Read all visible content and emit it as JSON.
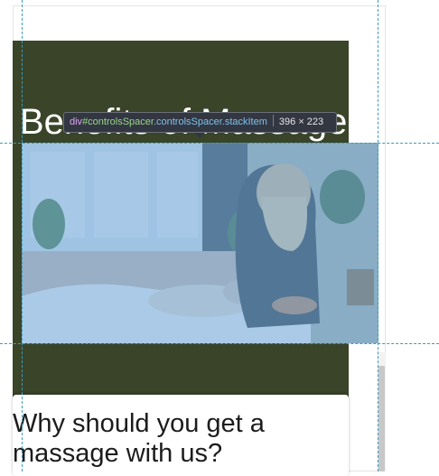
{
  "page": {
    "hero_title": "Benefits of Massage",
    "card_title": "Why should you get a massage with us?"
  },
  "devtools": {
    "tooltip": {
      "tag": "div",
      "id": "#controlsSpacer",
      "classes": ".controlsSpacer.stackItem",
      "size": "396 × 223"
    }
  },
  "images": {
    "hero_photo": "massage-photo"
  },
  "colors": {
    "hero_bg": "#3a4429",
    "highlight": "#6fa8dc",
    "tooltip_bg": "#333742",
    "guide": "#3b9bbd"
  }
}
